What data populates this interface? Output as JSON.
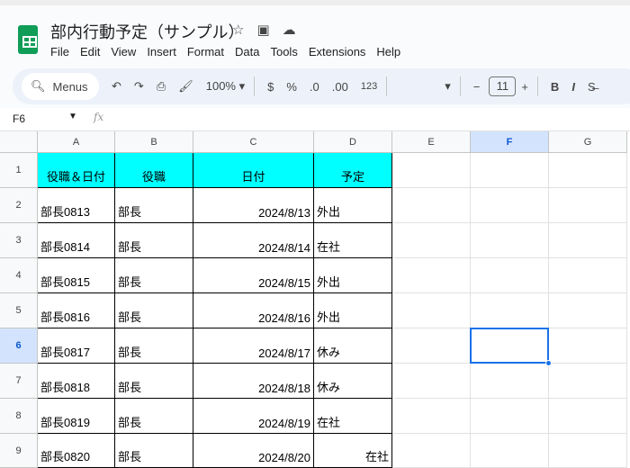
{
  "app": {
    "title": "部内行動予定（サンプル）",
    "icons": [
      "star-icon",
      "move-folder-icon",
      "cloud-status-icon"
    ]
  },
  "menu": [
    "File",
    "Edit",
    "View",
    "Insert",
    "Format",
    "Data",
    "Tools",
    "Extensions",
    "Help"
  ],
  "toolbar": {
    "search_label": "Menus",
    "zoom": "100%",
    "currency": "$",
    "percent": "%",
    "dec_decrease": ".0",
    "dec_increase": ".00",
    "format_123": "123",
    "font_size": "11",
    "bold": "B",
    "italic": "I"
  },
  "formula_bar": {
    "cell_ref": "F6",
    "fx": "fx",
    "value": ""
  },
  "columns": [
    "A",
    "B",
    "C",
    "D",
    "E",
    "F",
    "G"
  ],
  "rows": [
    "1",
    "2",
    "3",
    "4",
    "5",
    "6",
    "7",
    "8",
    "9"
  ],
  "selected_cell": "F6",
  "header_row": [
    "役職＆日付",
    "役職",
    "日付",
    "予定"
  ],
  "data_rows": [
    [
      "部長0813",
      "部長",
      "2024/8/13",
      "外出"
    ],
    [
      "部長0814",
      "部長",
      "2024/8/14",
      "在社"
    ],
    [
      "部長0815",
      "部長",
      "2024/8/15",
      "外出"
    ],
    [
      "部長0816",
      "部長",
      "2024/8/16",
      "外出"
    ],
    [
      "部長0817",
      "部長",
      "2024/8/17",
      "休み"
    ],
    [
      "部長0818",
      "部長",
      "2024/8/18",
      "休み"
    ],
    [
      "部長0819",
      "部長",
      "2024/8/19",
      "在社"
    ],
    [
      "部長0820",
      "部長",
      "2024/8/20",
      "在社"
    ]
  ],
  "colors": {
    "header_fill": "#00ffff",
    "selection": "#1a73e8"
  }
}
